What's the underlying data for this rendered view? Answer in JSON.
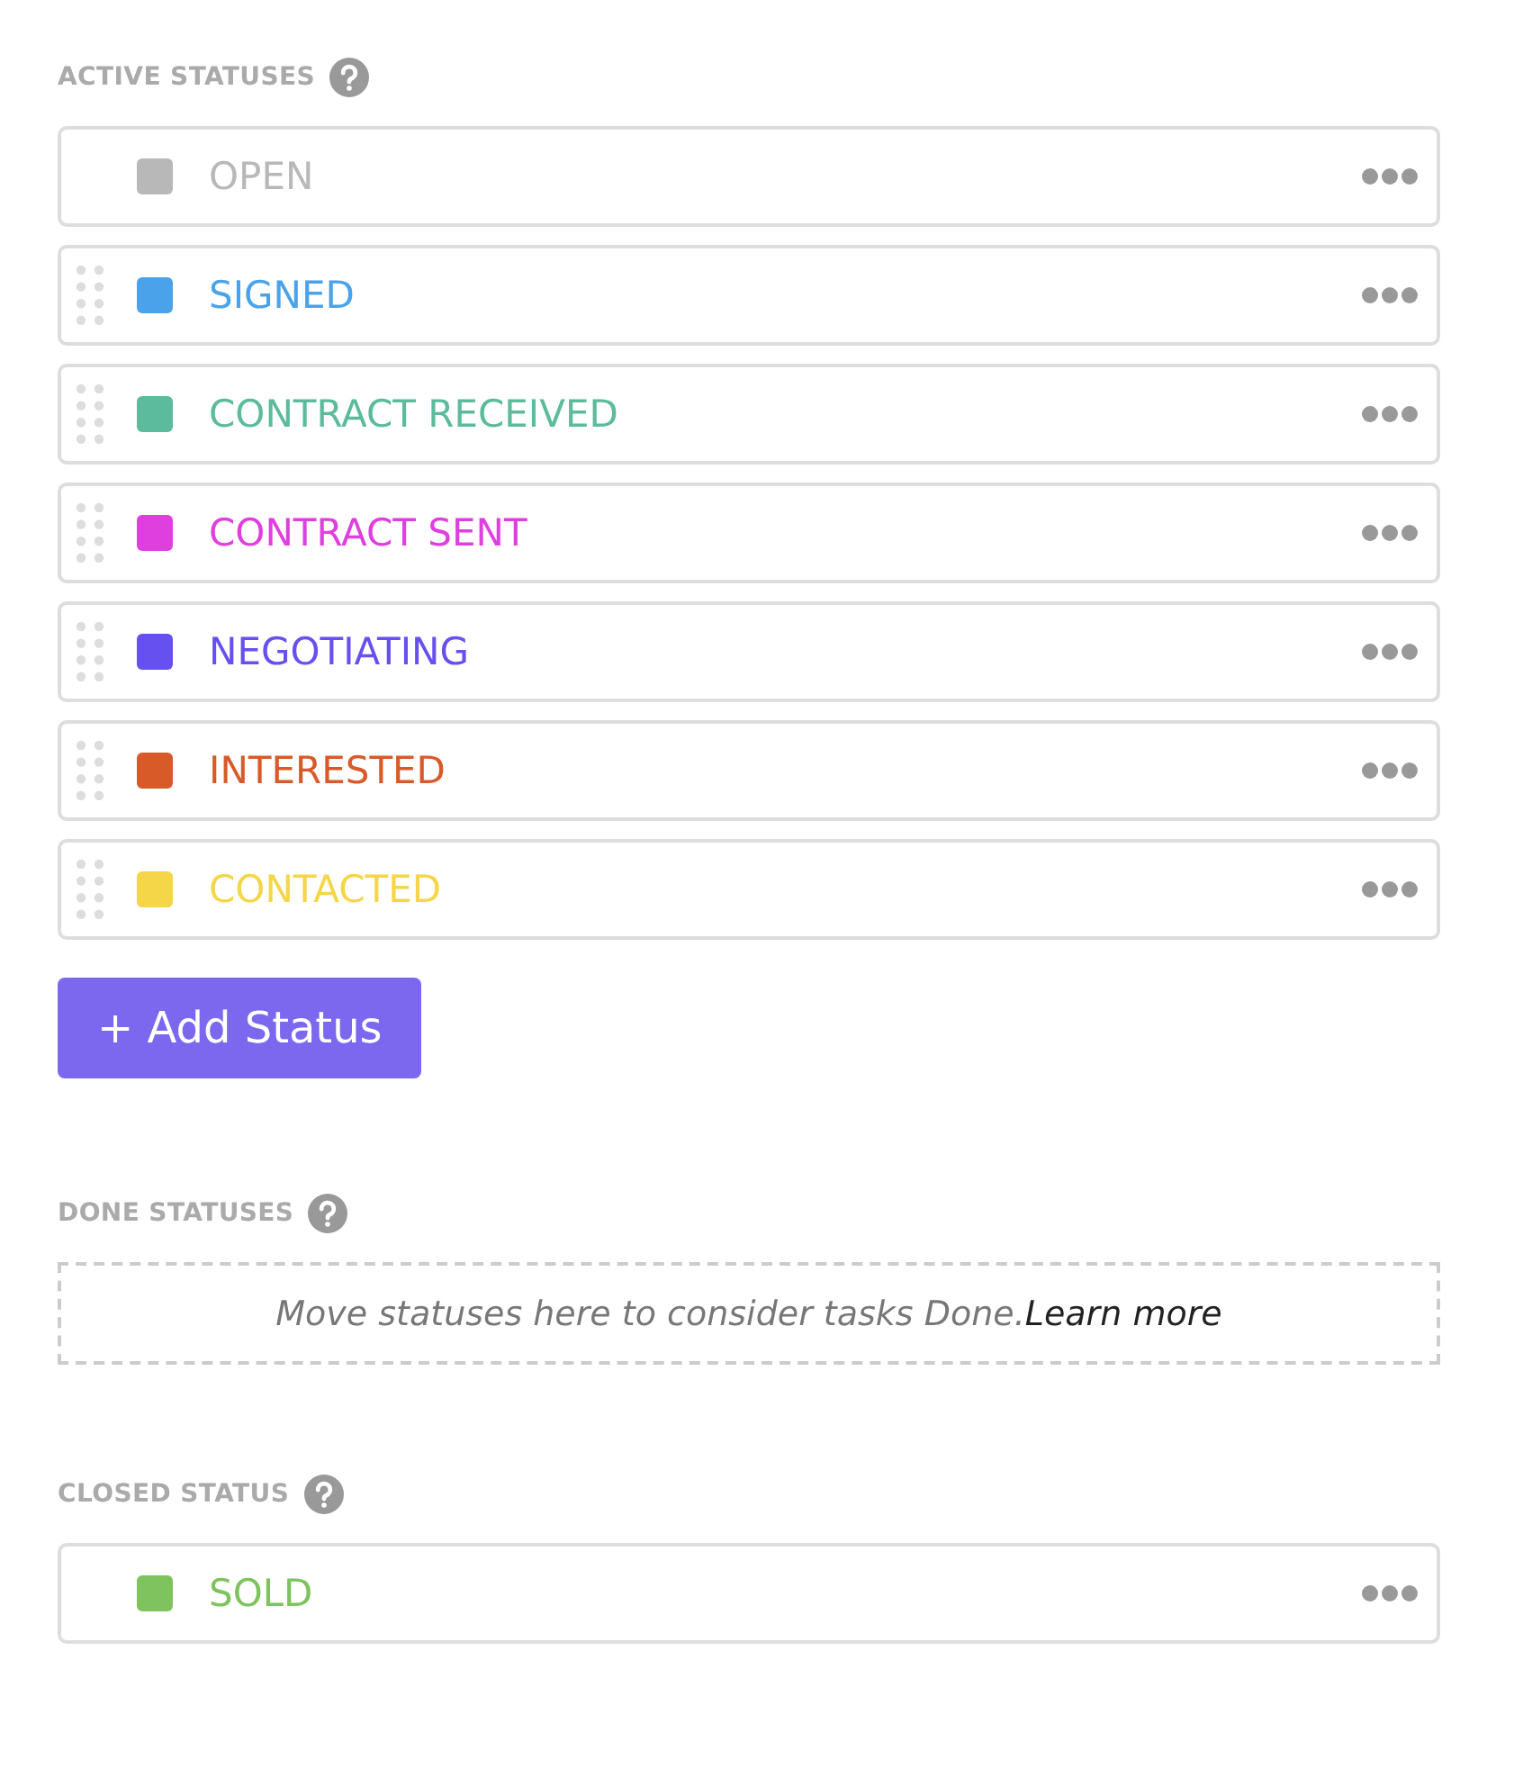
{
  "active_statuses": {
    "heading": "ACTIVE STATUSES",
    "items": [
      {
        "name": "OPEN",
        "color": "#b8b8b8",
        "draggable": false
      },
      {
        "name": "SIGNED",
        "color": "#4aa3ea",
        "draggable": true
      },
      {
        "name": "CONTRACT RECEIVED",
        "color": "#5bbb9c",
        "draggable": true
      },
      {
        "name": "CONTRACT SENT",
        "color": "#e03fe0",
        "draggable": true
      },
      {
        "name": "NEGOTIATING",
        "color": "#6650f0",
        "draggable": true
      },
      {
        "name": "INTERESTED",
        "color": "#d85a28",
        "draggable": true
      },
      {
        "name": "CONTACTED",
        "color": "#f4d648",
        "draggable": true
      }
    ],
    "add_button": "+ Add Status"
  },
  "done_statuses": {
    "heading": "DONE STATUSES",
    "hint": "Move statuses here to consider tasks Done.",
    "link": "Learn more"
  },
  "closed_status": {
    "heading": "CLOSED STATUS",
    "items": [
      {
        "name": "SOLD",
        "color": "#7ec35e",
        "draggable": false
      }
    ]
  }
}
